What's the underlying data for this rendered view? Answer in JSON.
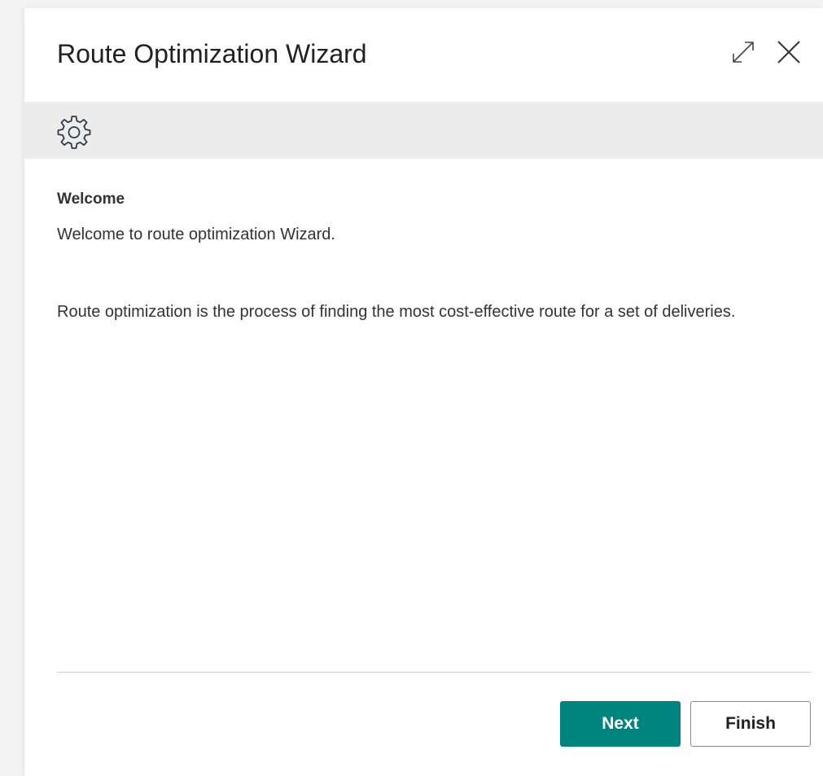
{
  "dialog": {
    "title": "Route Optimization Wizard",
    "actions": {
      "expand_icon": "expand-icon",
      "close_icon": "close-icon"
    }
  },
  "ribbon": {
    "icon": "gear-icon"
  },
  "content": {
    "heading": "Welcome",
    "welcome_text": "Welcome to route optimization Wizard.",
    "description": "Route optimization is the process of finding the most cost-effective route for a set of deliveries."
  },
  "footer": {
    "next_label": "Next",
    "finish_label": "Finish"
  },
  "colors": {
    "primary_button": "#00847f",
    "ribbon_background": "#ececec",
    "page_background": "#f3f3f3"
  }
}
